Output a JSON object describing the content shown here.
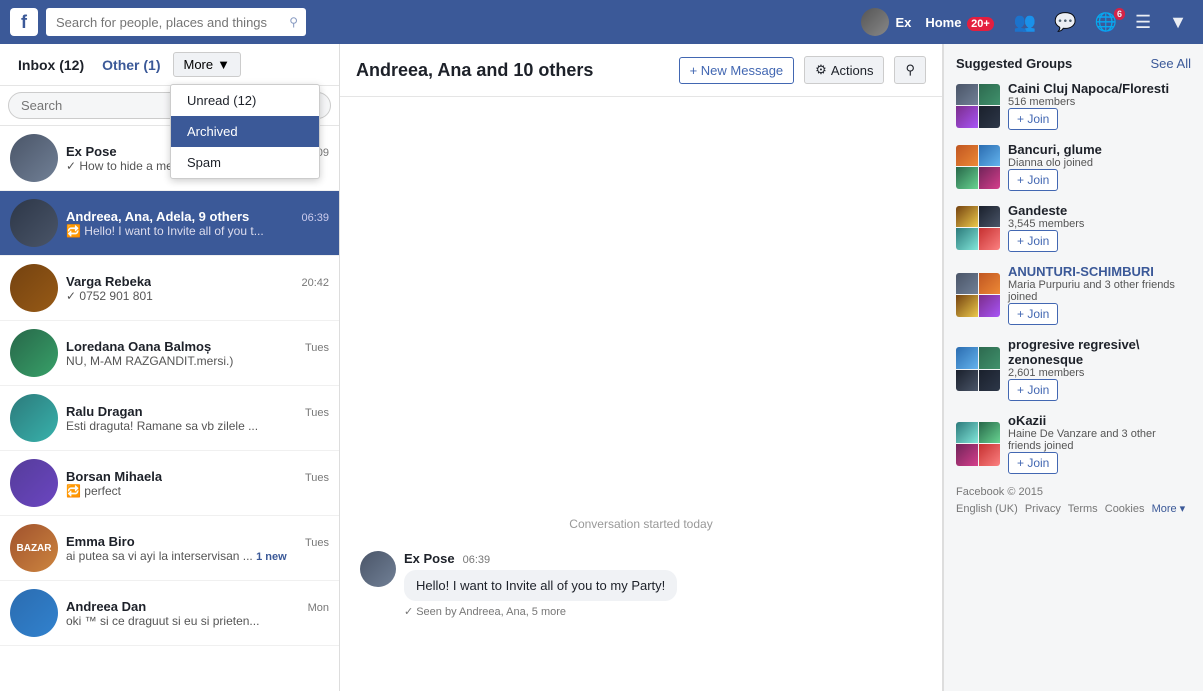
{
  "topnav": {
    "logo": "f",
    "search_placeholder": "Search for people, places and things",
    "user_name": "Ex",
    "home_label": "Home",
    "home_count": "20+",
    "globe_badge": "6"
  },
  "sidebar": {
    "inbox_label": "Inbox",
    "inbox_count": "(12)",
    "other_label": "Other",
    "other_count": "(1)",
    "more_label": "More",
    "search_placeholder": "Search",
    "dropdown": {
      "items": [
        {
          "label": "Unread (12)",
          "selected": false
        },
        {
          "label": "Archived",
          "selected": true
        },
        {
          "label": "Spam",
          "selected": false
        }
      ]
    },
    "messages": [
      {
        "name": "Ex Pose",
        "time": "07:09",
        "preview": "✓ How to hide a message on face...",
        "active": false,
        "avatar_class": "avatar-1"
      },
      {
        "name": "Andreea, Ana, Adela, 9 others",
        "time": "06:39",
        "preview": "🔁 Hello! I want to Invite all of you t...",
        "active": true,
        "avatar_class": "avatar-2"
      },
      {
        "name": "Varga Rebeka",
        "time": "20:42",
        "preview": "✓ 0752 901 801",
        "active": false,
        "avatar_class": "avatar-3"
      },
      {
        "name": "Loredana Oana Balmoș",
        "time": "Tues",
        "preview": "NU, M-AM RAZGANDIT.mersi.)",
        "active": false,
        "avatar_class": "avatar-4"
      },
      {
        "name": "Ralu Dragan",
        "time": "Tues",
        "preview": "Esti draguta! Ramane sa vb zilele ...",
        "active": false,
        "avatar_class": "avatar-5"
      },
      {
        "name": "Borsan Mihaela",
        "time": "Tues",
        "preview": "🔁 perfect",
        "active": false,
        "avatar_class": "avatar-6"
      },
      {
        "name": "Emma Biro",
        "time": "Tues",
        "preview": "ai putea sa vi ayi la interservisan ...",
        "new_label": "1 new",
        "active": false,
        "avatar_class": "avatar-emma"
      },
      {
        "name": "Andreea Dan",
        "time": "Mon",
        "preview": "oki ™ si ce draguut si eu si prieten...",
        "active": false,
        "avatar_class": "avatar-7"
      }
    ]
  },
  "chat": {
    "title": "Andreea, Ana and 10 others",
    "new_message_label": "+ New Message",
    "actions_label": "Actions",
    "conv_started": "Conversation started today",
    "messages": [
      {
        "sender": "Ex Pose",
        "time": "06:39",
        "text": "Hello! I want to Invite all of you to my Party!",
        "seen_by": "Seen by Andreea, Ana, 5 more"
      }
    ]
  },
  "right_sidebar": {
    "title": "Suggested Groups",
    "see_all": "See All",
    "groups": [
      {
        "name": "Caini Cluj Napoca/Floresti",
        "meta": "516 members",
        "join": "+ Join",
        "colors": [
          "gc1",
          "gc2",
          "gc3",
          "gc4"
        ]
      },
      {
        "name": "Bancuri, glume",
        "meta": "Dianna olo joined",
        "join": "+ Join",
        "colors": [
          "gc5",
          "gc6",
          "gc7",
          "gc8"
        ]
      },
      {
        "name": "Gandeste",
        "meta": "3,545 members",
        "join": "+ Join",
        "colors": [
          "gc9",
          "gc10",
          "gc11",
          "gc12"
        ]
      },
      {
        "name": "ANUNTURI-SCHIMBURI",
        "meta": "Maria Purpuriu and 3 other friends joined",
        "join": "+ Join",
        "blue_name": true,
        "colors": [
          "gc1",
          "gc5",
          "gc9",
          "gc3"
        ]
      },
      {
        "name": "progresive regresive\\ zenonesque",
        "meta": "2,601 members",
        "join": "+ Join",
        "colors": [
          "gc6",
          "gc2",
          "gc10",
          "gc4"
        ]
      },
      {
        "name": "oKazii",
        "meta": "Haine De Vanzare and 3 other friends joined",
        "join": "+ Join",
        "colors": [
          "gc11",
          "gc7",
          "gc8",
          "gc12"
        ]
      }
    ],
    "footer": {
      "copyright": "Facebook © 2015",
      "links": [
        "English (UK)",
        "Privacy",
        "Terms",
        "Cookies"
      ],
      "more": "More ▾"
    }
  }
}
